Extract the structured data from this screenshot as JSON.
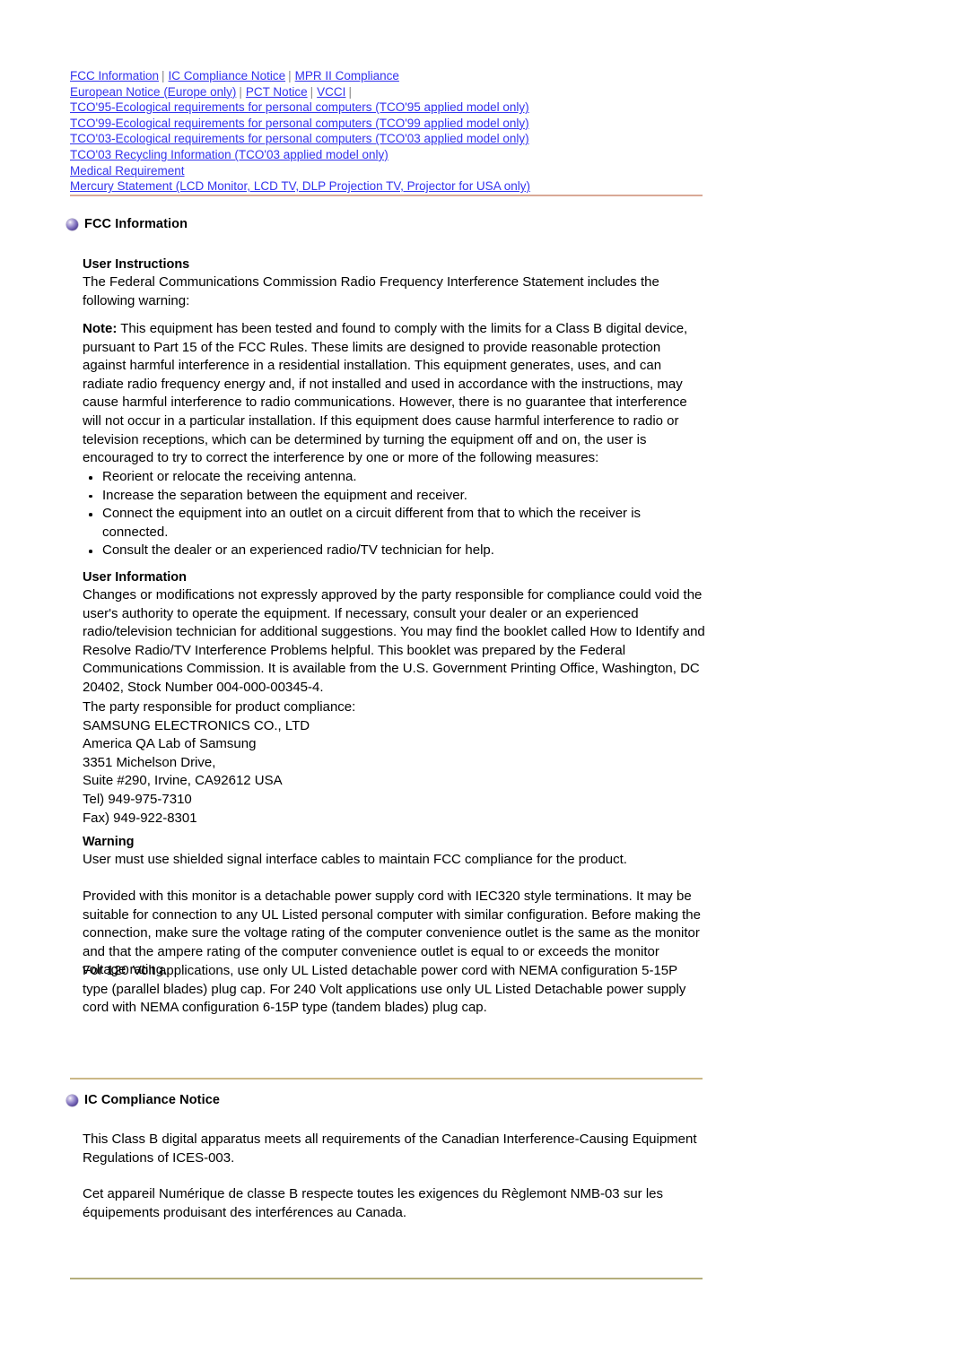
{
  "nav": {
    "separator": "|",
    "rows": [
      {
        "links": [
          "FCC Information",
          "IC Compliance Notice",
          "MPR II Compliance"
        ],
        "trailing_sep": false
      },
      {
        "links": [
          "European Notice (Europe only)",
          "PCT Notice",
          "VCCI"
        ],
        "trailing_sep": true
      },
      {
        "links": [
          "TCO'95-Ecological requirements for personal computers (TCO'95 applied model only)"
        ],
        "trailing_sep": false
      },
      {
        "links": [
          "TCO'99-Ecological requirements for personal computers (TCO'99 applied model only)"
        ],
        "trailing_sep": false
      },
      {
        "links": [
          "TCO'03-Ecological requirements for personal computers (TCO'03 applied model only)"
        ],
        "trailing_sep": false
      },
      {
        "links": [
          "TCO'03 Recycling Information (TCO'03 applied model only)"
        ],
        "trailing_sep": false
      },
      {
        "links": [
          "Medical Requirement"
        ],
        "trailing_sep": false
      },
      {
        "links": [
          "Mercury Statement (LCD Monitor, LCD TV, DLP Projection TV, Projector for USA only)"
        ],
        "trailing_sep": false
      }
    ]
  },
  "colors": {
    "link": "#3333ee",
    "rule_top": "#d9a996",
    "rule_mid": "#cbb887",
    "rule_bottom": "#b4ae7c",
    "bullet_sphere": "#5b4a9e",
    "text": "#000000"
  },
  "fcc": {
    "heading": "FCC Information",
    "user_instructions_heading": "User Instructions",
    "user_instructions_intro": "The Federal Communications Commission Radio Frequency Interference Statement includes the following warning:",
    "note_label": "Note:",
    "note_body": " This equipment has been tested and found to comply with the limits for a Class B digital device, pursuant to Part 15 of the FCC Rules. These limits are designed to provide reasonable protection against harmful interference in a residential installation. This equipment generates, uses, and can radiate radio frequency energy and, if not installed and used in accordance with the instructions, may cause harmful interference to radio communications. However, there is no guarantee that interference will not occur in a particular installation. If this equipment does cause harmful interference to radio or television receptions, which can be determined by turning the equipment off and on, the user is encouraged to try to correct the interference by one or more of the following measures:",
    "measures": [
      "Reorient or relocate the receiving antenna.",
      "Increase the separation between the equipment and receiver.",
      "Connect the equipment into an outlet on a circuit different from that to which the receiver is connected.",
      "Consult the dealer or an experienced radio/TV technician for help."
    ],
    "user_information_heading": "User Information",
    "user_information_body": "Changes or modifications not expressly approved by the party responsible for compliance could void the user's authority to operate the equipment. If necessary, consult your dealer or an experienced radio/television technician for additional suggestions. You may find the booklet called How to Identify and Resolve Radio/TV Interference Problems helpful. This booklet was prepared by the Federal Communications Commission. It is available from the U.S. Government Printing Office, Washington, DC 20402, Stock Number 004-000-00345-4.",
    "responsible_party": {
      "intro": "The party responsible for product compliance:",
      "company": "SAMSUNG ELECTRONICS CO., LTD",
      "division": "America QA Lab of Samsung",
      "street": "3351 Michelson Drive,",
      "city": "Suite #290, Irvine, CA92612 USA",
      "tel": "Tel) 949-975-7310",
      "fax": "Fax) 949-922-8301"
    },
    "warning_heading": "Warning",
    "warning_body": "User must use shielded signal interface cables to maintain FCC compliance for the product.",
    "warning_body2": "Provided with this monitor is a detachable power supply cord with IEC320 style terminations. It may be suitable for connection to any UL Listed personal computer with similar configuration. Before making the connection, make sure the voltage rating of the computer convenience outlet is the same as the monitor and that the ampere rating of the computer convenience outlet is equal to or exceeds the monitor voltage rating.",
    "warning_body3": "For 120 Volt applications, use only UL Listed detachable power cord with NEMA configuration 5-15P type (parallel blades) plug cap. For 240 Volt applications use only UL Listed Detachable power supply cord with NEMA configuration 6-15P type (tandem blades) plug cap."
  },
  "ic": {
    "heading": "IC Compliance Notice",
    "body_en": "This Class B digital apparatus meets all requirements of the Canadian Interference-Causing Equipment Regulations of ICES-003.",
    "body_fr": "Cet appareil Numérique de classe B respecte toutes les exigences du Règlemont NMB-03 sur les équipements produisant des interférences au Canada."
  }
}
